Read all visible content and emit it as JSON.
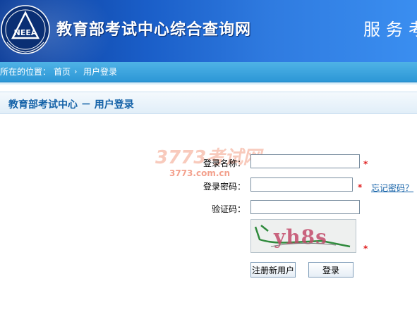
{
  "header": {
    "site_title": "教育部考试中心综合查询网",
    "slogan": "服务考",
    "logo_text": "NEEA"
  },
  "breadcrumb": {
    "prefix": "所在的位置：",
    "home": "首页",
    "separator": "›",
    "current": "用户登录"
  },
  "section": {
    "title": "教育部考试中心 － 用户登录"
  },
  "watermark": {
    "line1": "3773考试网",
    "line2": "3773.com.cn"
  },
  "form": {
    "username_label": "登录名称：",
    "username_value": "",
    "password_label": "登录密码：",
    "password_value": "",
    "captcha_label": "验证码：",
    "captcha_value": "",
    "required_mark": "*",
    "forgot_password": "忘记密码？",
    "captcha_text": "yh8s"
  },
  "buttons": {
    "register": "注册新用户",
    "login": "登录"
  },
  "colors": {
    "header_blue": "#1a5ec8",
    "breadcrumb_blue": "#2c97d6",
    "section_title": "#1462a8",
    "required_red": "#e02020"
  }
}
